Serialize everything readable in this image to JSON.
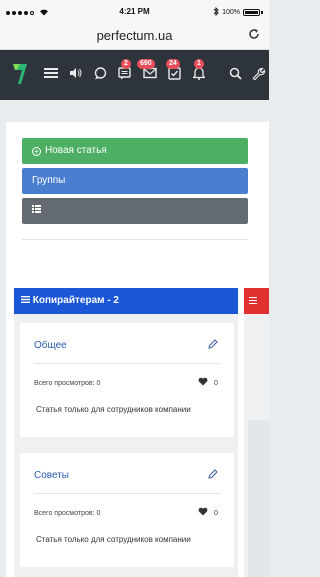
{
  "status_bar": {
    "time": "4:21 PM",
    "battery": "100%"
  },
  "browser": {
    "url": "perfectum.ua"
  },
  "navbar": {
    "badges": {
      "messages": "2",
      "mail": "690",
      "tasks": "24",
      "notifications": "1"
    }
  },
  "buttons": {
    "new_article": "Новая статья",
    "groups": "Группы"
  },
  "column": {
    "title": "Копирайтерам - 2"
  },
  "cards": [
    {
      "title": "Общее",
      "views_label": "Всего просмотров: 0",
      "likes": "0",
      "description": "Статья только для сотрудников компании"
    },
    {
      "title": "Советы",
      "views_label": "Всего просмотров: 0",
      "likes": "0",
      "description": "Статья только для сотрудников компании"
    }
  ],
  "colors": {
    "navbar": "#2d343b",
    "green": "#4caf63",
    "blue": "#4a7fd0",
    "gray": "#646a71",
    "column_header": "#1a56d6",
    "badge": "#e84f5b",
    "red_column": "#e03030"
  }
}
